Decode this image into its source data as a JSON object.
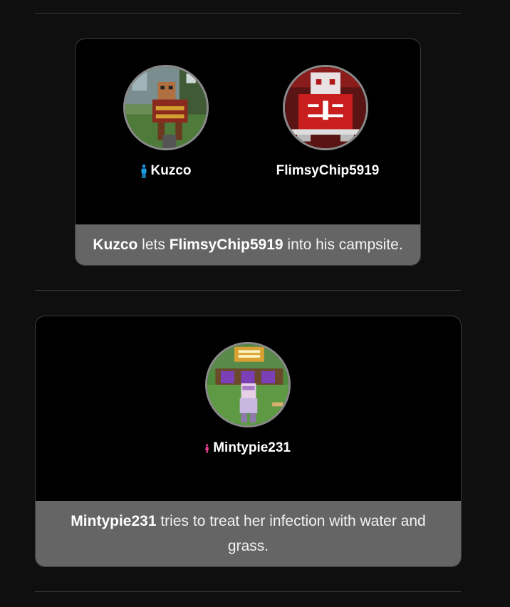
{
  "cards": [
    {
      "players": [
        {
          "name": "Kuzco",
          "gender_icon": "male-icon",
          "gender_color": "#1e9be6"
        },
        {
          "name": "FlimsyChip5919",
          "gender_icon": "male-icon",
          "gender_color": "#1e9be6"
        }
      ],
      "caption": {
        "name1": "Kuzco",
        "text1": " lets ",
        "name2": "FlimsyChip5919",
        "text2": " into his campsite."
      }
    },
    {
      "players": [
        {
          "name": "Mintypie231",
          "gender_icon": "female-icon",
          "gender_color": "#e83e8c"
        }
      ],
      "caption": {
        "name1": "Mintypie231",
        "text1": " tries to treat her infection with water and grass."
      }
    }
  ]
}
